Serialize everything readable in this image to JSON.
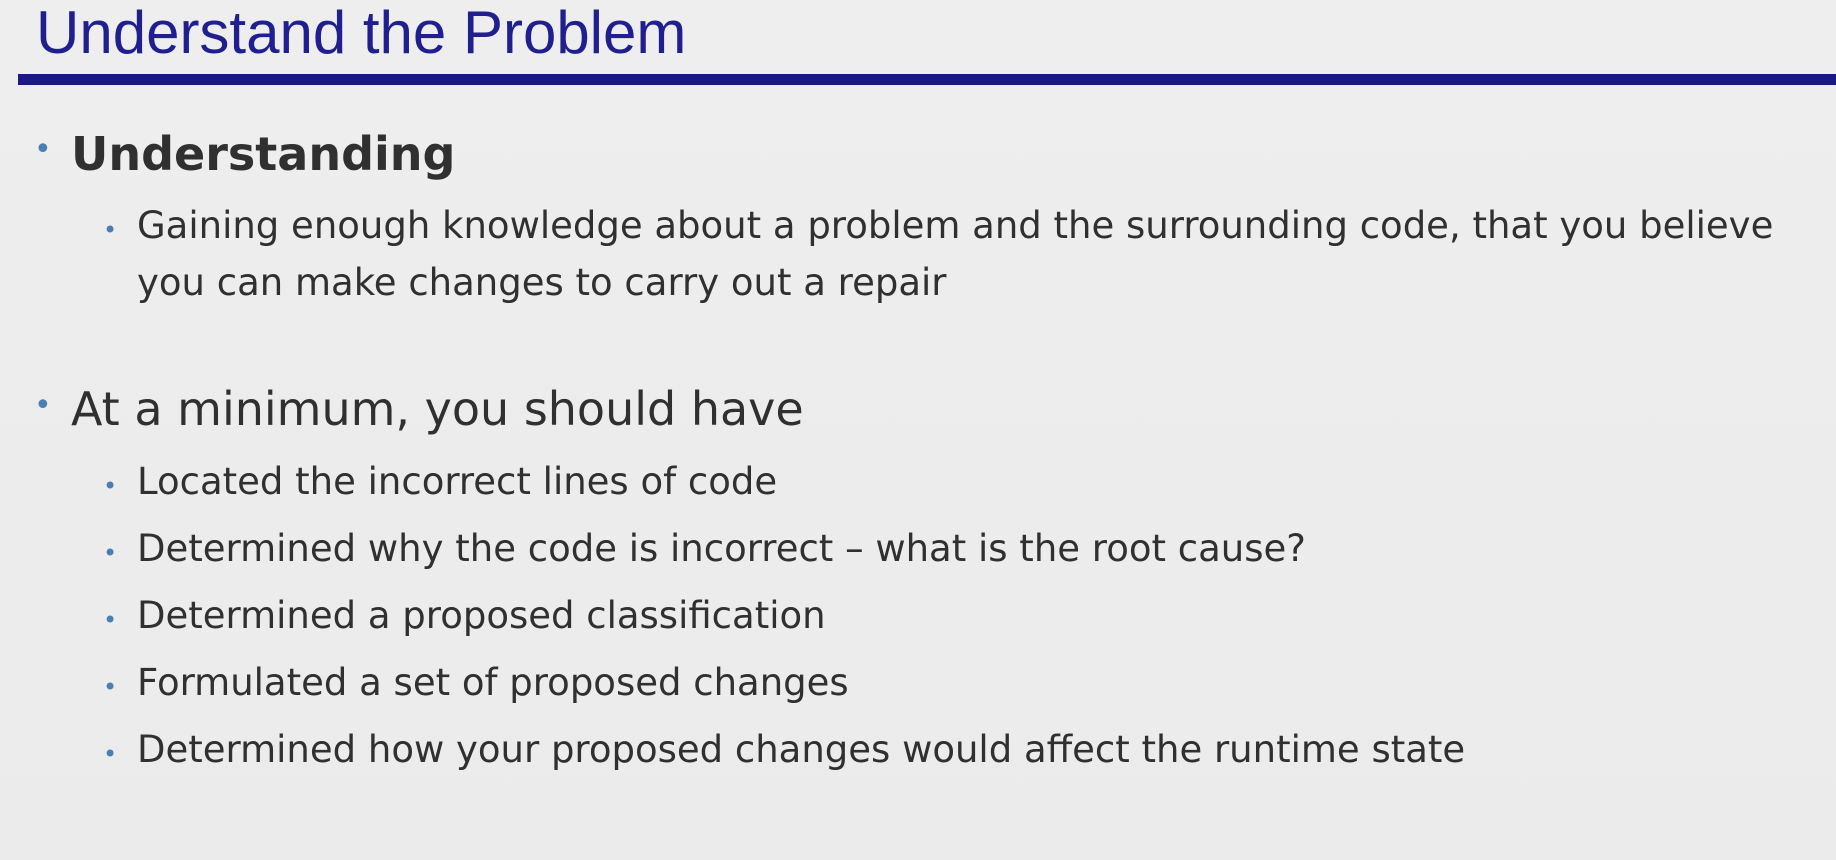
{
  "slide": {
    "title": "Understand the Problem",
    "bullets": [
      {
        "text": "Understanding",
        "subitems": [
          "Gaining enough knowledge about a problem and the surrounding code, that you believe",
          "you can make changes to carry out a repair"
        ]
      },
      {
        "text": "At a minimum, you should have",
        "subitems": [
          "Located the incorrect lines of code",
          "Determined why the code is incorrect – what is the root cause?",
          "Determined a proposed classification",
          "Formulated a set of proposed changes",
          "Determined how your proposed changes would affect the runtime state"
        ]
      }
    ],
    "bullet_glyph": "•",
    "colors": {
      "title": "#1f1f8f",
      "title_rule": "#1a1a80",
      "bullet": "#4a7fb3",
      "text": "#303030",
      "background": "#ececec"
    }
  }
}
